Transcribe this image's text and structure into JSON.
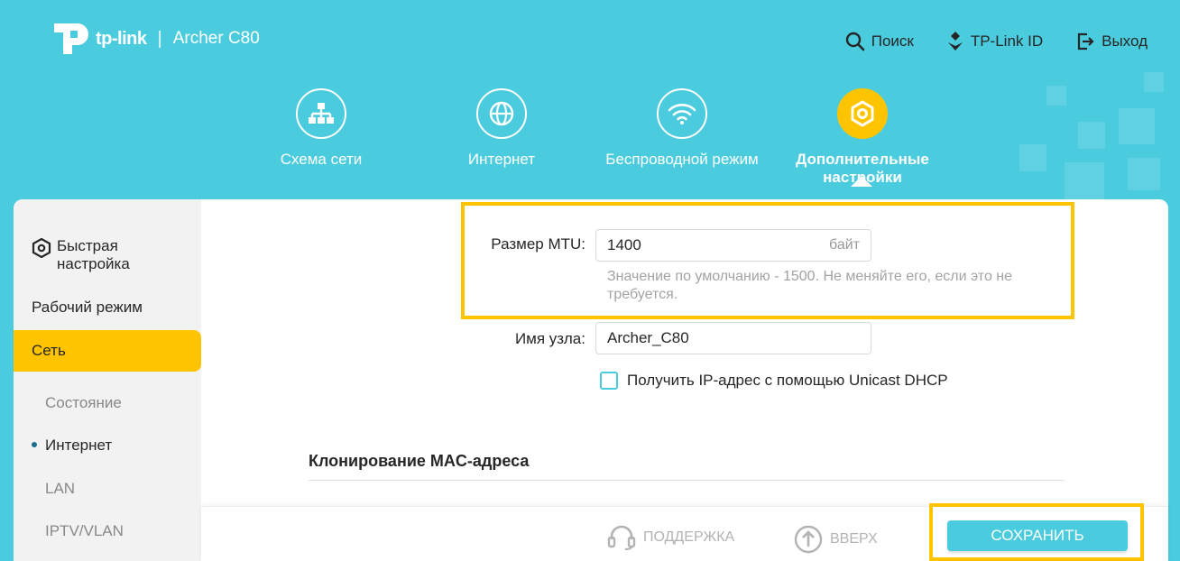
{
  "brand": {
    "logo_text": "tp-link",
    "separator": "|",
    "model": "Archer C80"
  },
  "top_actions": [
    {
      "label": "Поиск",
      "icon": "search-icon"
    },
    {
      "label": "TP-Link ID",
      "icon": "tplink-id-icon"
    },
    {
      "label": "Выход",
      "icon": "logout-icon"
    }
  ],
  "nav": [
    {
      "label": "Схема сети",
      "icon": "network-map-icon"
    },
    {
      "label": "Интернет",
      "icon": "globe-icon"
    },
    {
      "label": "Беспроводной режим",
      "icon": "wifi-icon"
    },
    {
      "label": "Дополнительные настройки",
      "icon": "advanced-gear-icon",
      "active": true
    }
  ],
  "sidebar": {
    "quick_setup": "Быстрая настройка",
    "operation_mode": "Рабочий режим",
    "network": "Сеть",
    "sub_items": [
      "Состояние",
      "Интернет",
      "LAN",
      "IPTV/VLAN"
    ],
    "current_sub": "Интернет"
  },
  "form": {
    "mtu_label": "Размер MTU:",
    "mtu_value": "1400",
    "mtu_unit": "байт",
    "mtu_hint": "Значение по умолчанию - 1500. Не меняйте его, если это не требуется.",
    "host_label": "Имя узла:",
    "host_value": "Archer_C80",
    "unicast_label": "Получить IP-адрес с помощью Unicast DHCP",
    "unicast_checked": false,
    "mac_clone_title": "Клонирование MAC-адреса"
  },
  "footer": {
    "support": "ПОДДЕРЖКА",
    "up": "ВВЕРХ",
    "save": "СОХРАНИТЬ"
  },
  "colors": {
    "header_bg": "#4acbde",
    "accent_yellow": "#ffc400",
    "save_button": "#4acbde"
  }
}
